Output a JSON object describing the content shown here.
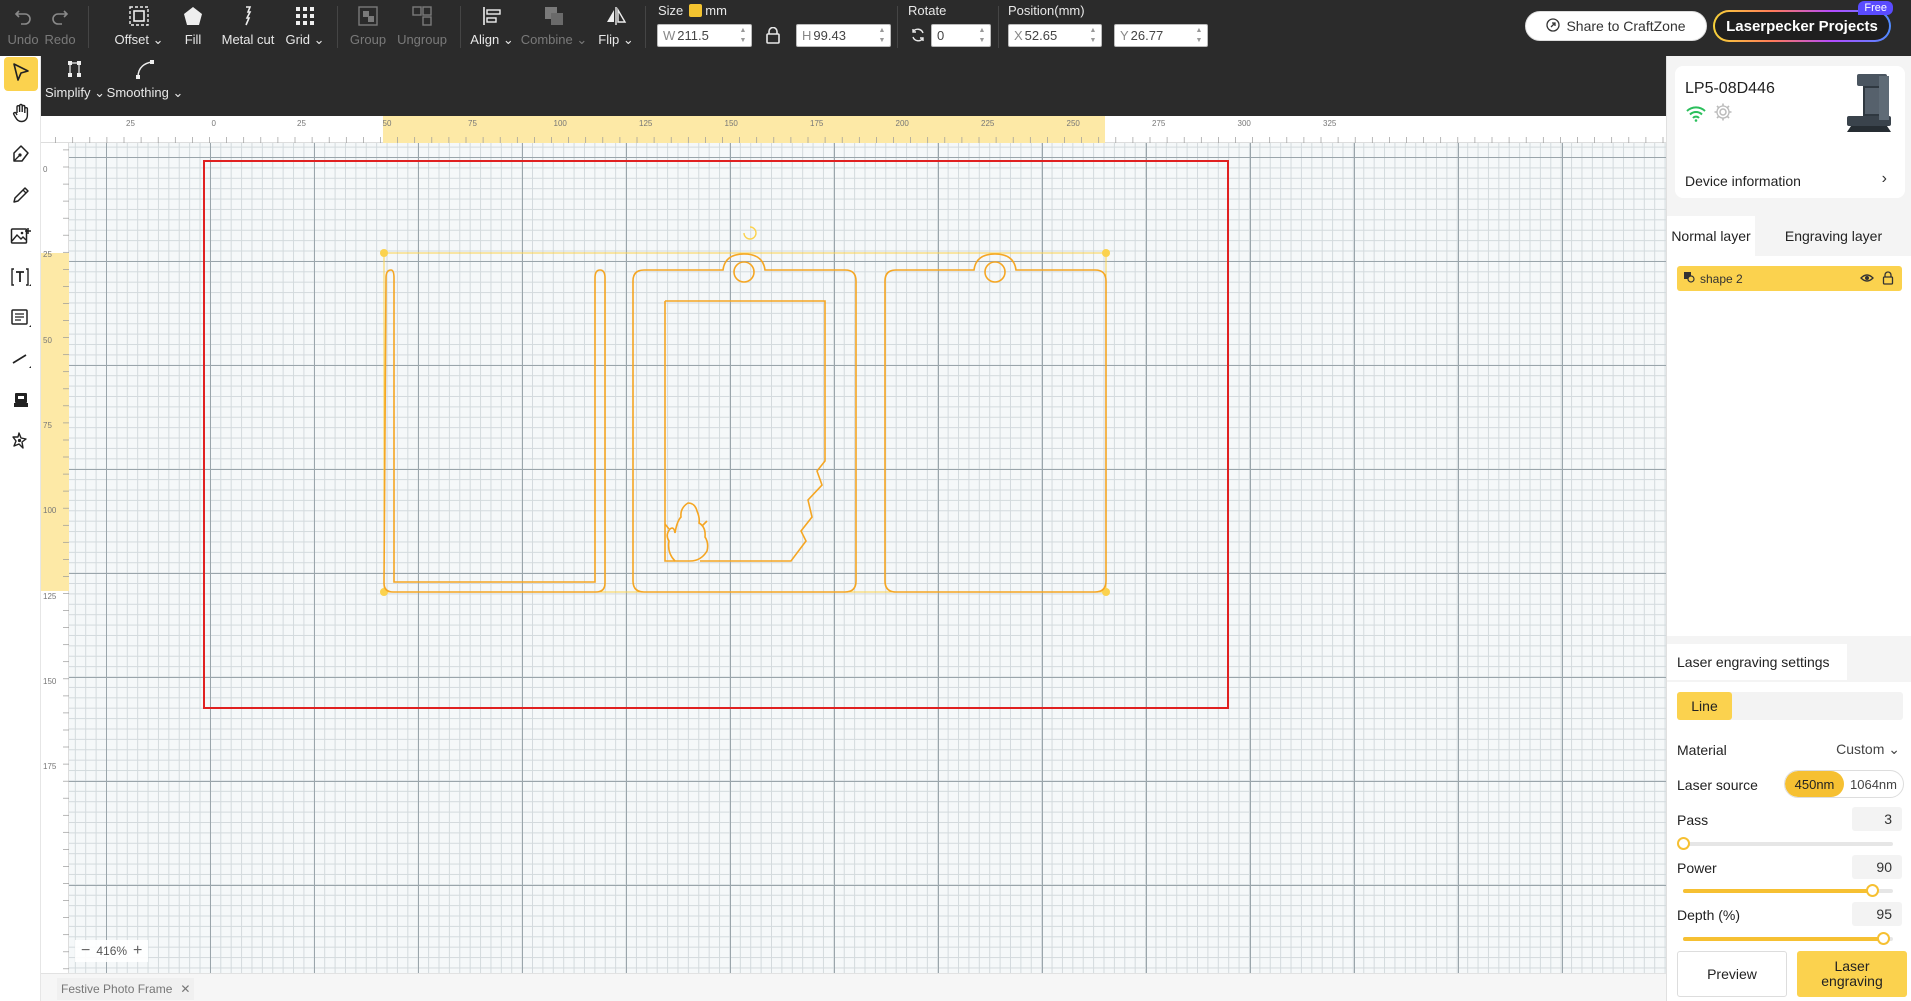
{
  "toolbar": {
    "undo": "Undo",
    "redo": "Redo",
    "offset": "Offset",
    "fill": "Fill",
    "metal_cut": "Metal cut",
    "grid": "Grid",
    "group": "Group",
    "ungroup": "Ungroup",
    "align": "Align",
    "combine": "Combine",
    "flip": "Flip"
  },
  "size": {
    "label": "Size",
    "unit": "mm",
    "w_prefix": "W",
    "w_value": "211.5",
    "h_prefix": "H",
    "h_value": "99.43"
  },
  "rotate": {
    "label": "Rotate",
    "value": "0"
  },
  "position": {
    "label": "Position(mm)",
    "x_prefix": "X",
    "x_value": "52.65",
    "y_prefix": "Y",
    "y_value": "26.77"
  },
  "header_actions": {
    "share": "Share to CraftZone",
    "projects": "Laserpecker Projects",
    "free_badge": "Free"
  },
  "subtoolbar": {
    "simplify": "Simplify",
    "smoothing": "Smoothing"
  },
  "rulers": {
    "top": [
      "25",
      "0",
      "25",
      "50",
      "75",
      "100",
      "125",
      "150",
      "175",
      "200",
      "225",
      "250",
      "275",
      "300",
      "325"
    ],
    "left": [
      "0",
      "25",
      "50",
      "75",
      "100",
      "125",
      "150",
      "175"
    ]
  },
  "canvas": {
    "zoom": "416%",
    "file_tab": "Festive Photo Frame",
    "colors": {
      "work_area": "#e02020",
      "shape": "#f5a623",
      "selection": "#fbd24e",
      "ruler_highlight": "#fde9a6"
    }
  },
  "device": {
    "name": "LP5-08D446",
    "info_label": "Device information"
  },
  "layers": {
    "tabs": [
      "Normal layer",
      "Engraving layer"
    ],
    "items": [
      {
        "name": "shape 2"
      }
    ]
  },
  "settings": {
    "title": "Laser engraving settings",
    "mode": "Line",
    "material_label": "Material",
    "material_value": "Custom",
    "laser_source_label": "Laser source",
    "laser_source_options": [
      "450nm",
      "1064nm"
    ],
    "laser_source_selected": "450nm",
    "pass_label": "Pass",
    "pass_value": "3",
    "pass_fraction": 0.0,
    "power_label": "Power",
    "power_value": "90",
    "power_fraction": 0.9,
    "depth_label": "Depth (%)",
    "depth_value": "95",
    "depth_fraction": 0.95,
    "preview_button": "Preview",
    "engrave_button": "Laser engraving"
  }
}
